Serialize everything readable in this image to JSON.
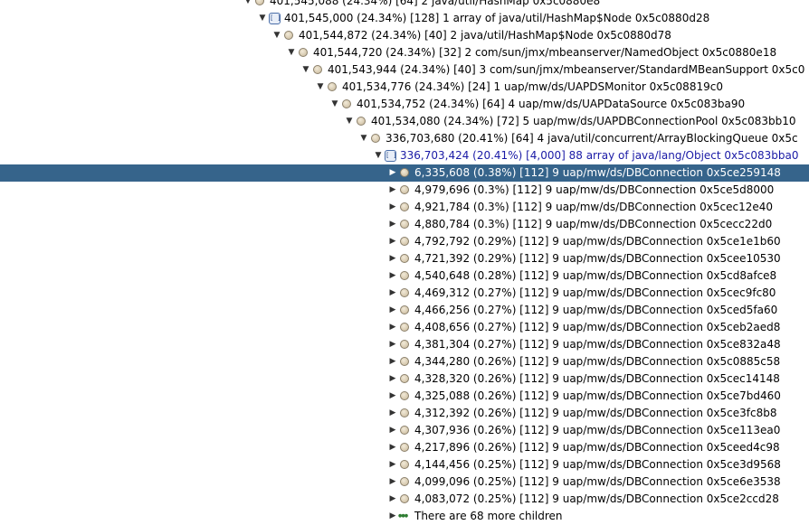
{
  "tree": {
    "rows": [
      {
        "text": "401,545,088 (24.34%) [64] 2 java/util/HashMap 0x5c0880e8",
        "depth": 0,
        "expanded": true,
        "icon": "object-icon"
      },
      {
        "text": "401,545,000 (24.34%) [128] 1 array of java/util/HashMap$Node 0x5c0880d28",
        "depth": 1,
        "expanded": true,
        "icon": "array-icon"
      },
      {
        "text": "401,544,872 (24.34%) [40] 2 java/util/HashMap$Node 0x5c0880d78",
        "depth": 2,
        "expanded": true,
        "icon": "object-icon"
      },
      {
        "text": "401,544,720 (24.34%) [32] 2 com/sun/jmx/mbeanserver/NamedObject 0x5c0880e18",
        "depth": 3,
        "expanded": true,
        "icon": "object-icon"
      },
      {
        "text": "401,543,944 (24.34%) [40] 3 com/sun/jmx/mbeanserver/StandardMBeanSupport 0x5c0",
        "depth": 4,
        "expanded": true,
        "icon": "object-icon"
      },
      {
        "text": "401,534,776 (24.34%) [24] 1 uap/mw/ds/UAPDSMonitor 0x5c08819c0",
        "depth": 5,
        "expanded": true,
        "icon": "object-icon"
      },
      {
        "text": "401,534,752 (24.34%) [64] 4 uap/mw/ds/UAPDataSource 0x5c083ba90",
        "depth": 6,
        "expanded": true,
        "icon": "object-icon"
      },
      {
        "text": "401,534,080 (24.34%) [72] 5 uap/mw/ds/UAPDBConnectionPool 0x5c083bb10",
        "depth": 7,
        "expanded": true,
        "icon": "object-icon"
      },
      {
        "text": "336,703,680 (20.41%) [64] 4 java/util/concurrent/ArrayBlockingQueue 0x5c",
        "depth": 8,
        "expanded": true,
        "icon": "object-icon"
      },
      {
        "text": "336,703,424 (20.41%) [4,000] 88 array of java/lang/Object 0x5c083bba0",
        "depth": 9,
        "expanded": true,
        "icon": "array-icon",
        "array": true
      },
      {
        "text": "6,335,608 (0.38%) [112] 9 uap/mw/ds/DBConnection 0x5ce259148",
        "depth": 10,
        "expanded": false,
        "icon": "object-icon",
        "selected": true
      },
      {
        "text": "4,979,696 (0.3%) [112] 9 uap/mw/ds/DBConnection 0x5ce5d8000",
        "depth": 10,
        "expanded": false,
        "icon": "object-icon"
      },
      {
        "text": "4,921,784 (0.3%) [112] 9 uap/mw/ds/DBConnection 0x5cec12e40",
        "depth": 10,
        "expanded": false,
        "icon": "object-icon"
      },
      {
        "text": "4,880,784 (0.3%) [112] 9 uap/mw/ds/DBConnection 0x5cecc22d0",
        "depth": 10,
        "expanded": false,
        "icon": "object-icon"
      },
      {
        "text": "4,792,792 (0.29%) [112] 9 uap/mw/ds/DBConnection 0x5ce1e1b60",
        "depth": 10,
        "expanded": false,
        "icon": "object-icon"
      },
      {
        "text": "4,721,392 (0.29%) [112] 9 uap/mw/ds/DBConnection 0x5cee10530",
        "depth": 10,
        "expanded": false,
        "icon": "object-icon"
      },
      {
        "text": "4,540,648 (0.28%) [112] 9 uap/mw/ds/DBConnection 0x5cd8afce8",
        "depth": 10,
        "expanded": false,
        "icon": "object-icon"
      },
      {
        "text": "4,469,312 (0.27%) [112] 9 uap/mw/ds/DBConnection 0x5cec9fc80",
        "depth": 10,
        "expanded": false,
        "icon": "object-icon"
      },
      {
        "text": "4,466,256 (0.27%) [112] 9 uap/mw/ds/DBConnection 0x5ced5fa60",
        "depth": 10,
        "expanded": false,
        "icon": "object-icon"
      },
      {
        "text": "4,408,656 (0.27%) [112] 9 uap/mw/ds/DBConnection 0x5ceb2aed8",
        "depth": 10,
        "expanded": false,
        "icon": "object-icon"
      },
      {
        "text": "4,381,304 (0.27%) [112] 9 uap/mw/ds/DBConnection 0x5ce832a48",
        "depth": 10,
        "expanded": false,
        "icon": "object-icon"
      },
      {
        "text": "4,344,280 (0.26%) [112] 9 uap/mw/ds/DBConnection 0x5c0885c58",
        "depth": 10,
        "expanded": false,
        "icon": "object-icon"
      },
      {
        "text": "4,328,320 (0.26%) [112] 9 uap/mw/ds/DBConnection 0x5cec14148",
        "depth": 10,
        "expanded": false,
        "icon": "object-icon"
      },
      {
        "text": "4,325,088 (0.26%) [112] 9 uap/mw/ds/DBConnection 0x5ce7bd460",
        "depth": 10,
        "expanded": false,
        "icon": "object-icon"
      },
      {
        "text": "4,312,392 (0.26%) [112] 9 uap/mw/ds/DBConnection 0x5ce3fc8b8",
        "depth": 10,
        "expanded": false,
        "icon": "object-icon"
      },
      {
        "text": "4,307,936 (0.26%) [112] 9 uap/mw/ds/DBConnection 0x5ce113ea0",
        "depth": 10,
        "expanded": false,
        "icon": "object-icon"
      },
      {
        "text": "4,217,896 (0.26%) [112] 9 uap/mw/ds/DBConnection 0x5ceed4c98",
        "depth": 10,
        "expanded": false,
        "icon": "object-icon"
      },
      {
        "text": "4,144,456 (0.25%) [112] 9 uap/mw/ds/DBConnection 0x5ce3d9568",
        "depth": 10,
        "expanded": false,
        "icon": "object-icon"
      },
      {
        "text": "4,099,096 (0.25%) [112] 9 uap/mw/ds/DBConnection 0x5ce6e3538",
        "depth": 10,
        "expanded": false,
        "icon": "object-icon"
      },
      {
        "text": "4,083,072 (0.25%) [112] 9 uap/mw/ds/DBConnection 0x5ce2ccd28",
        "depth": 10,
        "expanded": false,
        "icon": "object-icon"
      },
      {
        "text": "There are 68 more children",
        "depth": 10,
        "expanded": false,
        "icon": "more-icon",
        "more": true
      }
    ]
  },
  "colors": {
    "selection_bg": "#36648b",
    "selection_fg": "#ffffff",
    "array_text": "#1a1aa6"
  }
}
